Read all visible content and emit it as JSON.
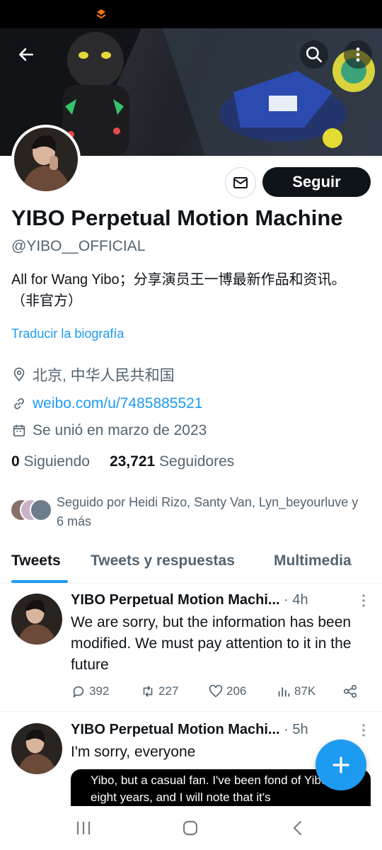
{
  "header": {
    "back_icon": "arrow-left-icon",
    "search_icon": "search-icon",
    "more_icon": "more-vertical-icon"
  },
  "profile": {
    "display_name": "YIBO Perpetual Motion Machine",
    "handle": "@YIBO__OFFICIAL",
    "bio": "All for Wang Yibo；分享演员王一博最新作品和资讯。（非官方）",
    "translate_label": "Traducir la biografía",
    "location": "北京, 中华人民共和国",
    "website": "weibo.com/u/7485885521",
    "joined": "Se unió en marzo de 2023",
    "following_count": "0",
    "following_label": "Siguiendo",
    "followers_count": "23,721",
    "followers_label": "Seguidores",
    "followed_by": "Seguido por Heidi Rizo, Santy Van, Lyn_beyourluve y 6 más",
    "follow_button": "Seguir"
  },
  "tabs": [
    {
      "label": "Tweets",
      "active": true
    },
    {
      "label": "Tweets y respuestas",
      "active": false
    },
    {
      "label": "Multimedia",
      "active": false
    }
  ],
  "tweets": [
    {
      "name": "YIBO Perpetual Motion Machi...",
      "time": "· 4h",
      "text": "We are sorry, but the information has been modified. We must pay attention to it in the future",
      "replies": "392",
      "retweets": "227",
      "likes": "206",
      "views": "87K"
    },
    {
      "name": "YIBO Perpetual Motion Machi...",
      "time": "· 5h",
      "text": "I'm sorry, everyone",
      "media_text": "Yibo, but a casual fan. I've been fond of Yibo for eight years, and I will note that it's"
    }
  ],
  "colors": {
    "accent": "#1d9bf0",
    "text": "#0f1419",
    "muted": "#536471"
  }
}
